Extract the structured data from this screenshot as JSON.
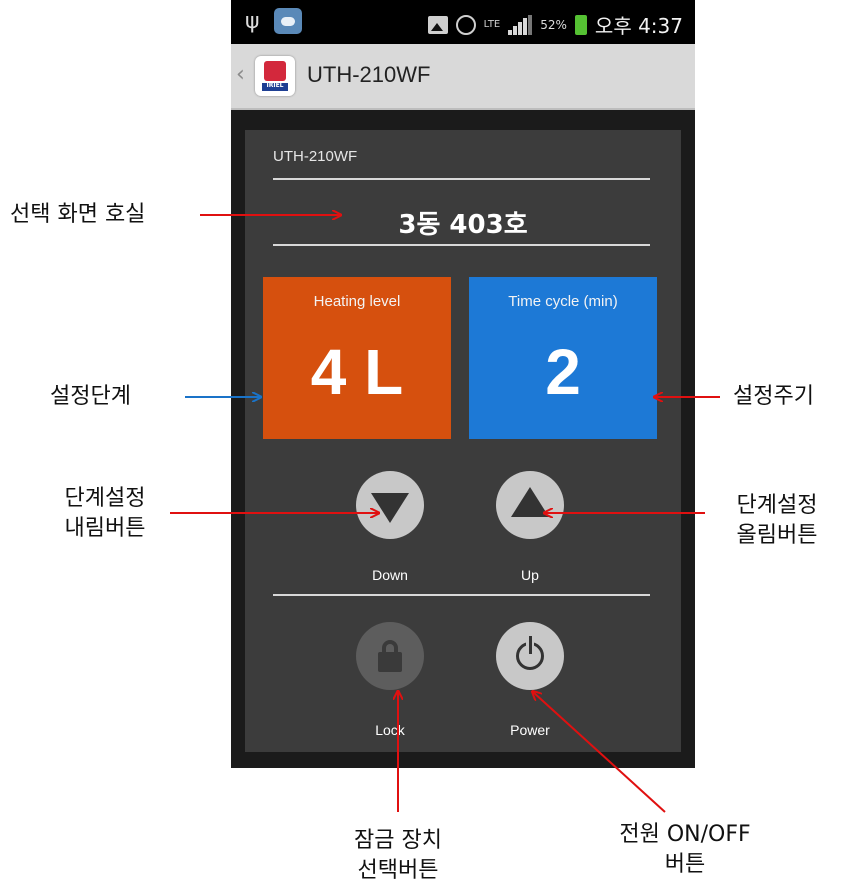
{
  "status_bar": {
    "lte": "LTE",
    "battery_percent": "52%",
    "time": "오후 4:37",
    "icons": [
      "usb-icon",
      "weather-icon",
      "image-icon",
      "alarm-icon",
      "lte-icon",
      "signal-icon",
      "battery-icon"
    ]
  },
  "app": {
    "back": "‹",
    "title": "UTH-210WF",
    "icon_label": "IRIEL"
  },
  "panel": {
    "model": "UTH-210WF",
    "room": "3동 403호",
    "heating": {
      "label": "Heating level",
      "value": "4 L"
    },
    "time_cycle": {
      "label": "Time cycle (min)",
      "value": "2"
    },
    "down_label": "Down",
    "up_label": "Up",
    "lock_label": "Lock",
    "power_label": "Power"
  },
  "colors": {
    "heating_tile": "#d6500e",
    "time_tile": "#1d79d6",
    "arrow_red": "#e01010",
    "arrow_blue": "#1a73c8"
  },
  "annotations": {
    "room_select": "선택 화면 호실",
    "level_setting": "설정단계",
    "cycle_setting": "설정주기",
    "down_button_l1": "단계설정",
    "down_button_l2": "내림버튼",
    "up_button_l1": "단계설정",
    "up_button_l2": "올림버튼",
    "lock_button_l1": "잠금 장치",
    "lock_button_l2": "선택버튼",
    "power_button_l1": "전원 ON/OFF",
    "power_button_l2": "버튼"
  }
}
